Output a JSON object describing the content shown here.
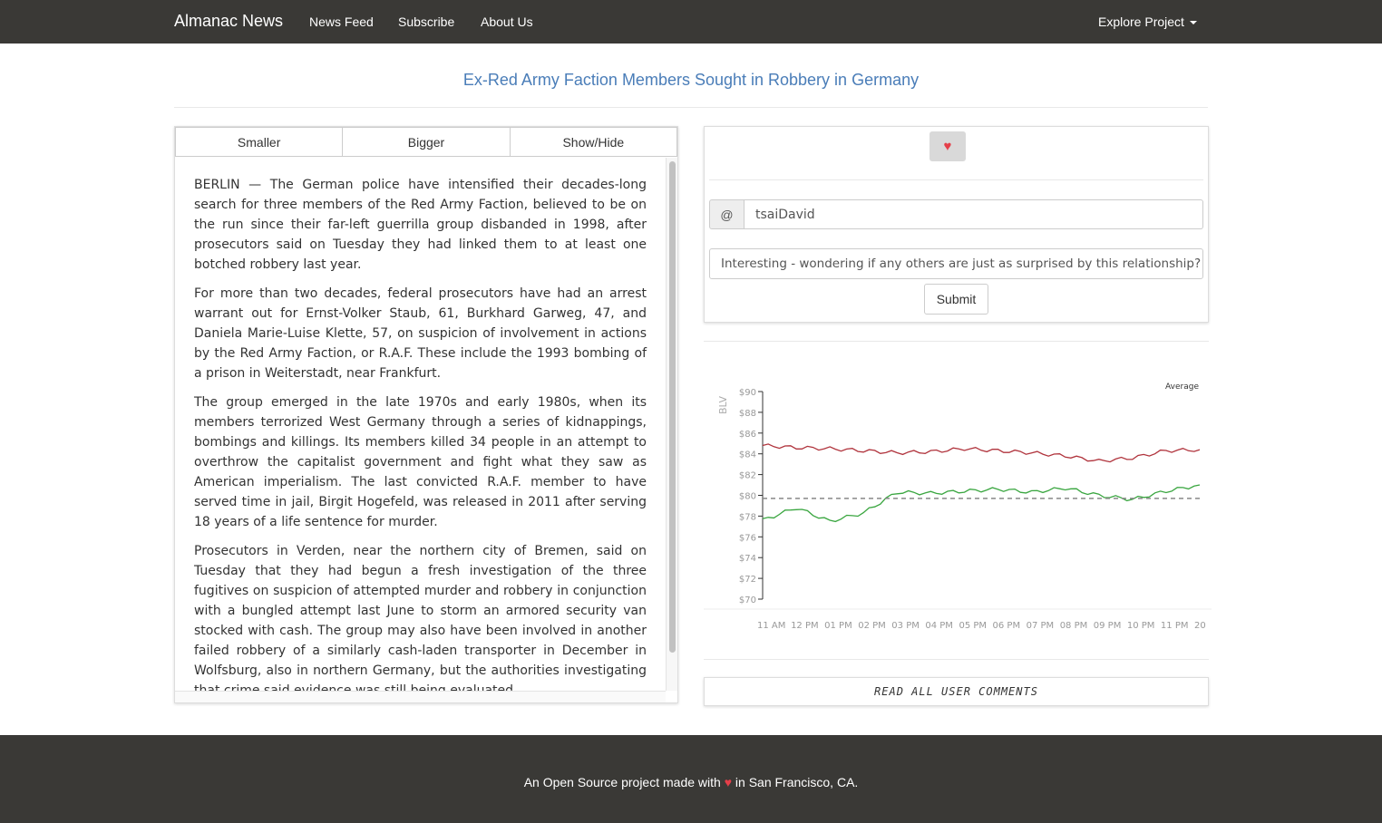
{
  "navbar": {
    "brand": "Almanac News",
    "links": [
      "News Feed",
      "Subscribe",
      "About Us"
    ],
    "dropdown": "Explore Project"
  },
  "article": {
    "title": "Ex-Red Army Faction Members Sought in Robbery in Germany",
    "controls": {
      "smaller": "Smaller",
      "bigger": "Bigger",
      "toggle": "Show/Hide"
    },
    "paragraphs": [
      "BERLIN — The German police have intensified their decades-long search for three members of the Red Army Faction, believed to be on the run since their far-left guerrilla group disbanded in 1998, after prosecutors said on Tuesday they had linked them to at least one botched robbery last year.",
      "For more than two decades, federal prosecutors have had an arrest warrant out for Ernst-Volker Staub, 61, Burkhard Garweg, 47, and Daniela Marie-Luise Klette, 57, on suspicion of involvement in actions by the Red Army Faction, or R.A.F. These include the 1993 bombing of a prison in Weiterstadt, near Frankfurt.",
      "The group emerged in the late 1970s and early 1980s, when its members terrorized West Germany through a series of kidnappings, bombings and killings. Its members killed 34 people in an attempt to overthrow the capitalist government and fight what they saw as American imperialism. The last convicted R.A.F. member to have served time in jail, Birgit Hogefeld, was released in 2011 after serving 18 years of a life sentence for murder.",
      "Prosecutors in Verden, near the northern city of Bremen, said on Tuesday that they had begun a fresh investigation of the three fugitives on suspicion of attempted murder and robbery in conjunction with a bungled attempt last June to storm an armored security van stocked with cash. The group may also have been involved in another failed robbery of a similarly cash-laden transporter in December in Wolfsburg, also in northern Germany, but the authorities investigating that crime said evidence was still being evaluated."
    ]
  },
  "comment_form": {
    "like_icon": "heart-icon",
    "addon": "@",
    "username": "tsaiDavid",
    "comment": "Interesting - wondering if any others are just as surprised by this relationship?",
    "submit": "Submit"
  },
  "chart_data": {
    "type": "line",
    "ylabel": "BLV",
    "ylim": [
      70,
      90
    ],
    "yticks": [
      "$90",
      "$88",
      "$86",
      "$84",
      "$82",
      "$80",
      "$78",
      "$76",
      "$74",
      "$72",
      "$70"
    ],
    "x": [
      "11 AM",
      "12 PM",
      "01 PM",
      "02 PM",
      "03 PM",
      "04 PM",
      "05 PM",
      "06 PM",
      "07 PM",
      "08 PM",
      "09 PM",
      "10 PM",
      "11 PM",
      "20"
    ],
    "legend": "Average",
    "series": [
      {
        "color": "#b0333c",
        "values": [
          84.8,
          84.6,
          84.5,
          84.3,
          84.1,
          84.2,
          84.5,
          84.3,
          84.1,
          83.8,
          83.3,
          83.6,
          84.3,
          84.4
        ]
      },
      {
        "color": "#3aa640",
        "values": [
          77.6,
          78.8,
          77.5,
          78.3,
          80.3,
          80.2,
          80.4,
          80.6,
          80.3,
          80.7,
          80.0,
          79.6,
          80.4,
          81.0
        ]
      },
      {
        "name": "Average",
        "color": "#888888",
        "dashed": true,
        "values": [
          79.7,
          79.7,
          79.7,
          79.7,
          79.7,
          79.7,
          79.7,
          79.7,
          79.7,
          79.7,
          79.7,
          79.7,
          79.7,
          79.7
        ]
      }
    ]
  },
  "read_all": "READ ALL USER COMMENTS",
  "footer": {
    "before": "An Open Source project made with",
    "heart": "♥",
    "after": "in San Francisco, CA."
  }
}
